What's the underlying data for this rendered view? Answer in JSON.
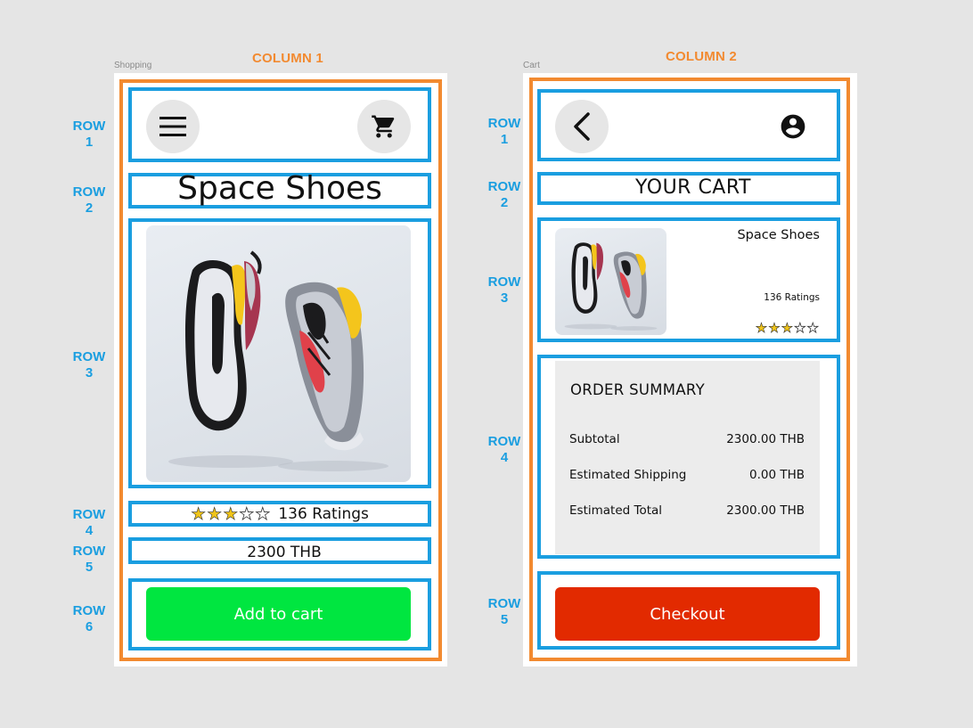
{
  "annotations": {
    "column1": "COLUMN   1",
    "column2": "COLUMN   2",
    "left_rows": [
      {
        "line1": "ROW",
        "line2": "1"
      },
      {
        "line1": "ROW",
        "line2": "2"
      },
      {
        "line1": "ROW",
        "line2": "3"
      },
      {
        "line1": "ROW",
        "line2": "4"
      },
      {
        "line1": "ROW",
        "line2": "5"
      },
      {
        "line1": "ROW",
        "line2": "6"
      }
    ],
    "right_rows": [
      {
        "line1": "ROW",
        "line2": "1"
      },
      {
        "line1": "ROW",
        "line2": "2"
      },
      {
        "line1": "ROW",
        "line2": "3"
      },
      {
        "line1": "ROW",
        "line2": "4"
      },
      {
        "line1": "ROW",
        "line2": "5"
      }
    ]
  },
  "frames": {
    "shopping_label": "Shopping",
    "cart_label": "Cart"
  },
  "shopping": {
    "menu_icon": "hamburger-menu-icon",
    "cart_icon": "shopping-cart-icon",
    "title": "Space Shoes",
    "rating_stars": 3,
    "rating_max": 5,
    "ratings_text": "136 Ratings",
    "price": "2300 THB",
    "add_to_cart_label": "Add to cart",
    "add_to_cart_color": "#00e640"
  },
  "cart": {
    "back_icon": "chevron-left-icon",
    "account_icon": "account-circle-icon",
    "title": "YOUR CART",
    "item": {
      "name": "Space Shoes",
      "ratings_text": "136 Ratings",
      "rating_stars": 3,
      "rating_max": 5
    },
    "summary": {
      "heading": "ORDER SUMMARY",
      "rows": [
        {
          "label": "Subtotal",
          "value": "2300.00 THB"
        },
        {
          "label": "Estimated Shipping",
          "value": "0.00 THB"
        },
        {
          "label": "Estimated Total",
          "value": "2300.00 THB"
        }
      ]
    },
    "checkout_label": "Checkout",
    "checkout_color": "#e22a00"
  },
  "colors": {
    "column_outline": "#f28a30",
    "row_outline": "#1a9ee0"
  }
}
